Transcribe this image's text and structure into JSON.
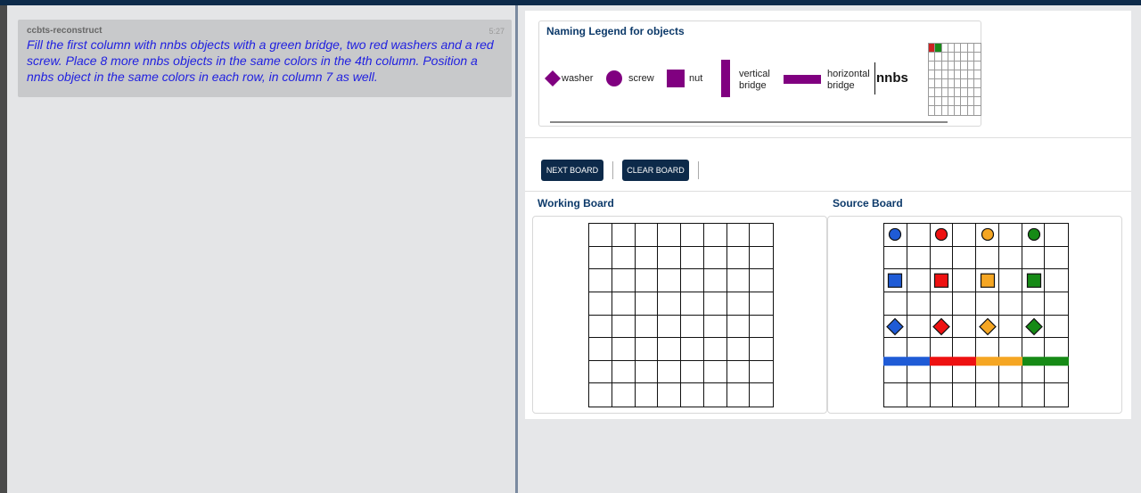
{
  "chat": {
    "sender": "ccbts-reconstruct",
    "time": "5:27",
    "message": "Fill the first column with nnbs objects with a green bridge, two red washers and a red screw. Place 8 more nnbs objects in the same colors in the 4th column. Position a nnbs object in the same colors in each row, in column 7 as well."
  },
  "legend": {
    "title": "Naming Legend for objects",
    "washer": "washer",
    "screw": "screw",
    "nut": "nut",
    "vertical_bridge_1": "vertical",
    "vertical_bridge_2": "bridge",
    "horizontal_bridge_1": "horizontal",
    "horizontal_bridge_2": "bridge",
    "nnbs": "nnbs",
    "color": "#800080"
  },
  "buttons": {
    "next_board": "NEXT BOARD",
    "clear_board": "CLEAR BOARD"
  },
  "boards": {
    "working_title": "Working Board",
    "source_title": "Source Board",
    "source_colors": [
      "#1f5bd6",
      "#ee1111",
      "#f5a623",
      "#168a16"
    ]
  }
}
